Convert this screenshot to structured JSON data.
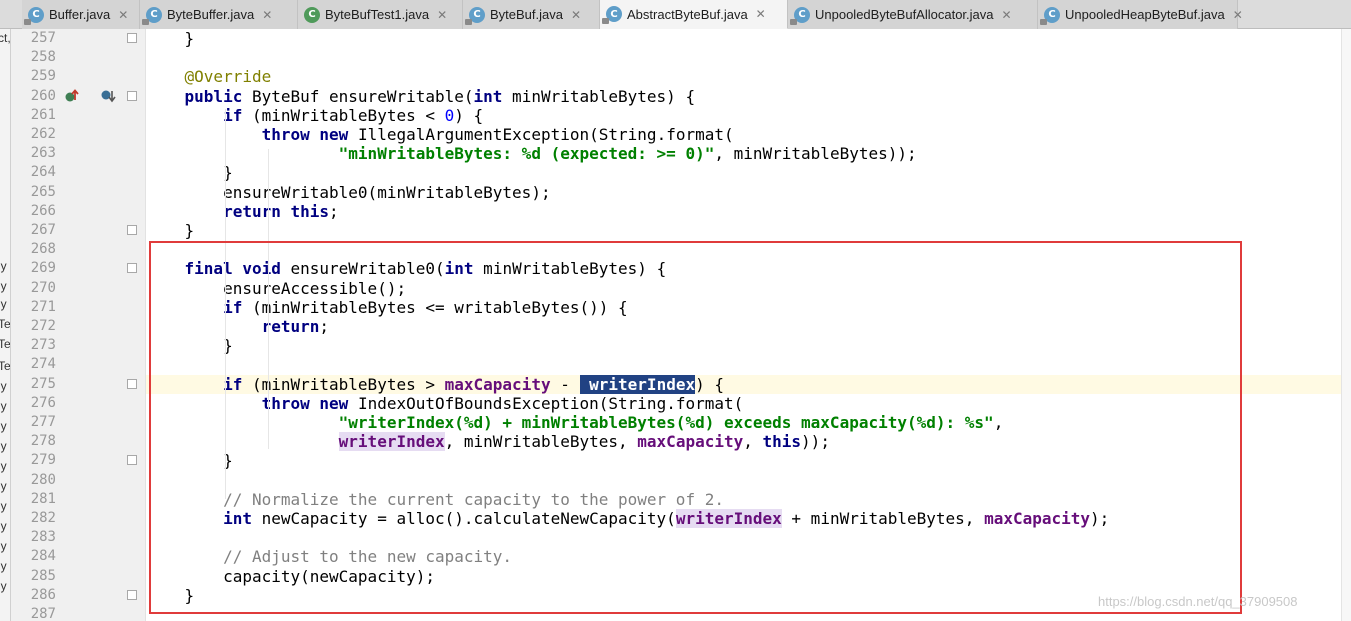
{
  "tabs": [
    {
      "label": "Buffer.java",
      "close": "✕",
      "icon": "class-icon-locked"
    },
    {
      "label": "ByteBuffer.java",
      "close": "✕",
      "icon": "class-icon-locked"
    },
    {
      "label": "ByteBufTest1.java",
      "close": "✕",
      "icon": "class-icon-runnable"
    },
    {
      "label": "ByteBuf.java",
      "close": "✕",
      "icon": "class-icon-locked"
    },
    {
      "label": "AbstractByteBuf.java",
      "close": "✕",
      "icon": "class-icon-locked",
      "active": true
    },
    {
      "label": "UnpooledByteBufAllocator.java",
      "close": "✕",
      "icon": "class-icon-locked"
    },
    {
      "label": "UnpooledHeapByteBuf.java",
      "close": "✕",
      "icon": "class-icon-locked"
    }
  ],
  "left_strip": [
    "ct,",
    "iy",
    "iy",
    "iy",
    "Te",
    "Te",
    "Te",
    "iy",
    "iy",
    "iy",
    "iy",
    "iy",
    "iy",
    "iy",
    "iy",
    "iy",
    "iy",
    "iy"
  ],
  "line_numbers": [
    "257",
    "258",
    "259",
    "260",
    "261",
    "262",
    "263",
    "264",
    "265",
    "266",
    "267",
    "268",
    "269",
    "270",
    "271",
    "272",
    "273",
    "274",
    "275",
    "276",
    "277",
    "278",
    "279",
    "280",
    "281",
    "282",
    "283",
    "284",
    "285",
    "286",
    "287"
  ],
  "code_lines": [
    [
      {
        "t": "    }"
      }
    ],
    [],
    [
      {
        "t": "    "
      },
      {
        "t": "@Override",
        "c": "ann"
      }
    ],
    [
      {
        "t": "    "
      },
      {
        "t": "public",
        "c": "kw"
      },
      {
        "t": " ByteBuf ensureWritable("
      },
      {
        "t": "int",
        "c": "kw"
      },
      {
        "t": " minWritableBytes) {"
      }
    ],
    [
      {
        "t": "        "
      },
      {
        "t": "if",
        "c": "kw"
      },
      {
        "t": " (minWritableBytes < "
      },
      {
        "t": "0",
        "c": "num"
      },
      {
        "t": ") {"
      }
    ],
    [
      {
        "t": "            "
      },
      {
        "t": "throw",
        "c": "kw"
      },
      {
        "t": " "
      },
      {
        "t": "new",
        "c": "kw"
      },
      {
        "t": " IllegalArgumentException(String.format("
      }
    ],
    [
      {
        "t": "                    "
      },
      {
        "t": "\"minWritableBytes: %d (expected: >= 0)\"",
        "c": "str"
      },
      {
        "t": ", minWritableBytes));"
      }
    ],
    [
      {
        "t": "        }"
      }
    ],
    [
      {
        "t": "        ensureWritable0(minWritableBytes);"
      }
    ],
    [
      {
        "t": "        "
      },
      {
        "t": "return",
        "c": "kw"
      },
      {
        "t": " "
      },
      {
        "t": "this",
        "c": "kw"
      },
      {
        "t": ";"
      }
    ],
    [
      {
        "t": "    }"
      }
    ],
    [],
    [
      {
        "t": "    "
      },
      {
        "t": "final",
        "c": "kw"
      },
      {
        "t": " "
      },
      {
        "t": "void",
        "c": "kw"
      },
      {
        "t": " ensureWritable0("
      },
      {
        "t": "int",
        "c": "kw"
      },
      {
        "t": " minWritableBytes) {"
      }
    ],
    [
      {
        "t": "        ensureAccessible();"
      }
    ],
    [
      {
        "t": "        "
      },
      {
        "t": "if",
        "c": "kw"
      },
      {
        "t": " (minWritableBytes <= writableBytes()) {"
      }
    ],
    [
      {
        "t": "            "
      },
      {
        "t": "return",
        "c": "kw"
      },
      {
        "t": ";"
      }
    ],
    [
      {
        "t": "        }"
      }
    ],
    [],
    [
      {
        "t": "        "
      },
      {
        "t": "if",
        "c": "kw"
      },
      {
        "t": " (minWritableBytes > "
      },
      {
        "t": "maxCapacity",
        "c": "fld"
      },
      {
        "t": " - "
      },
      {
        "t": " writerIndex",
        "c": "fld sel"
      },
      {
        "t": ") {"
      }
    ],
    [
      {
        "t": "            "
      },
      {
        "t": "throw",
        "c": "kw"
      },
      {
        "t": " "
      },
      {
        "t": "new",
        "c": "kw"
      },
      {
        "t": " IndexOutOfBoundsException(String.format("
      }
    ],
    [
      {
        "t": "                    "
      },
      {
        "t": "\"writerIndex(%d) + minWritableBytes(%d) exceeds maxCapacity(%d): %s\"",
        "c": "str"
      },
      {
        "t": ","
      }
    ],
    [
      {
        "t": "                    "
      },
      {
        "t": "writerIndex",
        "c": "fld ul"
      },
      {
        "t": ", minWritableBytes, "
      },
      {
        "t": "maxCapacity",
        "c": "fld"
      },
      {
        "t": ", "
      },
      {
        "t": "this",
        "c": "kw"
      },
      {
        "t": "));"
      }
    ],
    [
      {
        "t": "        }"
      }
    ],
    [],
    [
      {
        "t": "        "
      },
      {
        "t": "// Normalize the current capacity to the power of 2.",
        "c": "cmt"
      }
    ],
    [
      {
        "t": "        "
      },
      {
        "t": "int",
        "c": "kw"
      },
      {
        "t": " newCapacity = alloc().calculateNewCapacity("
      },
      {
        "t": "writerIndex",
        "c": "fld ul"
      },
      {
        "t": " + minWritableBytes, "
      },
      {
        "t": "maxCapacity",
        "c": "fld"
      },
      {
        "t": ");"
      }
    ],
    [],
    [
      {
        "t": "        "
      },
      {
        "t": "// Adjust to the new capacity.",
        "c": "cmt"
      }
    ],
    [
      {
        "t": "        capacity(newCapacity);"
      }
    ],
    [
      {
        "t": "    }"
      }
    ],
    []
  ],
  "highlight_line": "275",
  "gutter_icons": [
    {
      "line": "260",
      "icon": "override-up-icon"
    },
    {
      "line": "260",
      "icon": "implemented-down-icon"
    },
    {
      "line": "275",
      "icon": "lightbulb-icon"
    }
  ],
  "fold_lines": [
    "257",
    "260",
    "267",
    "269",
    "275",
    "279",
    "286"
  ],
  "watermark": "https://blog.csdn.net/qq_37909508",
  "colors": {
    "keyword": "#000080",
    "annotation": "#808000",
    "string": "#008000",
    "field": "#660e7a",
    "comment": "#808080",
    "selection": "#214283",
    "callout": "#e03b3b"
  }
}
